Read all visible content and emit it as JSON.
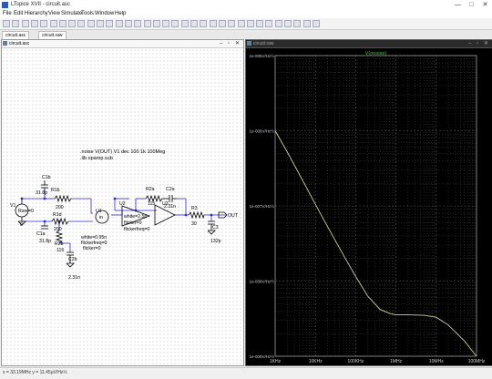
{
  "app": {
    "window_title": "LTspice XVII - circuit.asc",
    "window_controls": [
      "—",
      "□",
      "✕"
    ]
  },
  "menu": [
    "File",
    "Edit",
    "Hierarchy",
    "View",
    "Simulate",
    "Tools",
    "Window",
    "Help"
  ],
  "toolbar": {
    "button_count": 34
  },
  "tabs": [
    "circuit.asc",
    "circuit.raw"
  ],
  "schematic": {
    "window_title": "circuit.asc",
    "directives": [
      ".noise V(OUT) V1 dec 100 1k 100Meg",
      ".lib opamp.sub"
    ],
    "components": {
      "c1b": "C1b",
      "c1b_val": "31.8p",
      "r1b": "R1b",
      "r1b_val": "200",
      "v1": "V1",
      "v1_val": "Rser=0",
      "v1_zero": "0",
      "r1d": "R1d",
      "r1d_val": "200",
      "c1a": "C1a",
      "c1a_val": "31.8p",
      "r2b": "R2b",
      "r2b_val": "115",
      "c2b": "C2b",
      "c2b_val": "2.31n",
      "u1": "U1",
      "u1_sym": "in",
      "u1_params": [
        "white=0.95n",
        "flickerfreq=0",
        "flicker=0"
      ],
      "u2": "U2",
      "u2_params": [
        "white=2.5p",
        "flicker=0",
        "flickerfreq=0"
      ],
      "r2a": "R2a",
      "r2a_val": "115",
      "c2a": "C2a",
      "c2a_val": "2.31n",
      "u3": "U3",
      "r3": "R3",
      "r3_val": "30",
      "c3": "C3",
      "c3_val": "132p",
      "out": "OUT"
    }
  },
  "plot": {
    "window_title": "circuit.raw",
    "trace_label": "V(onoise)",
    "colors": {
      "background": "#000000",
      "grid": "#5a5a5a",
      "trace": "#cfcfa0",
      "label": "#2fd02f"
    }
  },
  "chart_data": {
    "type": "line",
    "title": "V(onoise)",
    "x_scale": "log",
    "y_scale": "log",
    "xlim": [
      1000,
      100000000
    ],
    "ylim": [
      1e-09,
      1e-05
    ],
    "xticks": [
      "1KHz",
      "10KHz",
      "100KHz",
      "1MHz",
      "10MHz",
      "100MHz"
    ],
    "yticks": [
      "1e-005V/Hz½",
      "1e-006V/Hz½",
      "1e-007V/Hz½",
      "1e-008V/Hz½",
      "1e-009V/Hz½"
    ],
    "grid": true,
    "series": [
      {
        "name": "V(onoise)",
        "x": [
          1000,
          2000,
          5000,
          10000,
          20000,
          50000,
          100000,
          200000,
          400000,
          700000,
          1000000,
          2000000,
          5000000,
          10000000,
          20000000,
          50000000,
          100000000
        ],
        "y": [
          1e-06,
          5.2e-07,
          2.1e-07,
          1.05e-07,
          5.3e-08,
          2.2e-08,
          1.15e-08,
          6.3e-09,
          4.2e-09,
          3.7e-09,
          3.55e-09,
          3.55e-09,
          3.5e-09,
          3.3e-09,
          2.6e-09,
          1.6e-09,
          1e-09
        ]
      }
    ]
  },
  "status": {
    "text": "x = 33.19MHz   y = 11.45μV/Hz½"
  }
}
